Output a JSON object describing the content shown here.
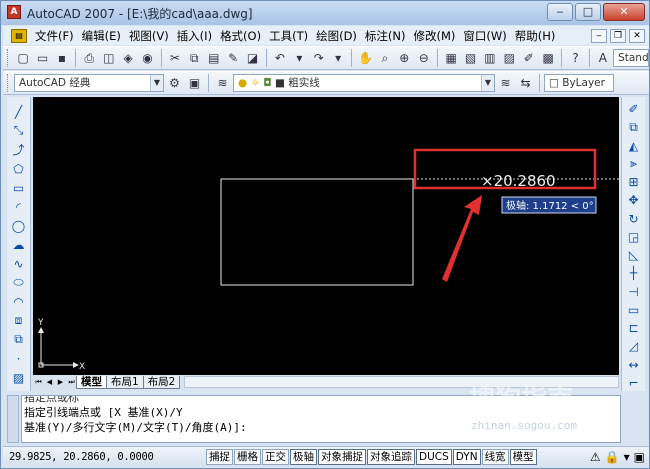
{
  "window": {
    "title": "AutoCAD 2007 - [E:\\我的cad\\aaa.dwg]",
    "minimize": "‒",
    "maximize": "□",
    "close": "✕"
  },
  "menu": [
    "文件(F)",
    "编辑(E)",
    "视图(V)",
    "插入(I)",
    "格式(O)",
    "工具(T)",
    "绘图(D)",
    "标注(N)",
    "修改(M)",
    "窗口(W)",
    "帮助(H)"
  ],
  "toolbar": {
    "text_style": "Stand",
    "workspace": "AutoCAD 经典",
    "layer_line": "粗实线",
    "linetype": "ByLayer"
  },
  "canvas": {
    "dim_value": "×20.2860",
    "tooltip": "极轴: 1.1712 < 0°",
    "ucs_y": "Y",
    "ucs_x": "X",
    "colors": {
      "background": "#000000",
      "rectangle": "#e8e8e8",
      "highlight_box": "#e03030",
      "arrow": "#e03030",
      "tooltip_bg": "#1e3e8a"
    }
  },
  "tabs": [
    "模型",
    "布局1",
    "布局2"
  ],
  "command": {
    "cut_line": "指定点或标",
    "line1": "指定引线端点或 [X 基准(X)/Y",
    "line2": "基准(Y)/多行文字(M)/文字(T)/角度(A)]:"
  },
  "status": {
    "coords": "29.9825, 20.2860, 0.0000",
    "buttons": [
      "捕捉",
      "栅格",
      "正交",
      "极轴",
      "对象捕捉",
      "对象追踪",
      "DUCS",
      "DYN",
      "线宽",
      "模型"
    ]
  },
  "watermark": {
    "brand": "搜狗指南",
    "url": "zhinan.sogou.com"
  }
}
